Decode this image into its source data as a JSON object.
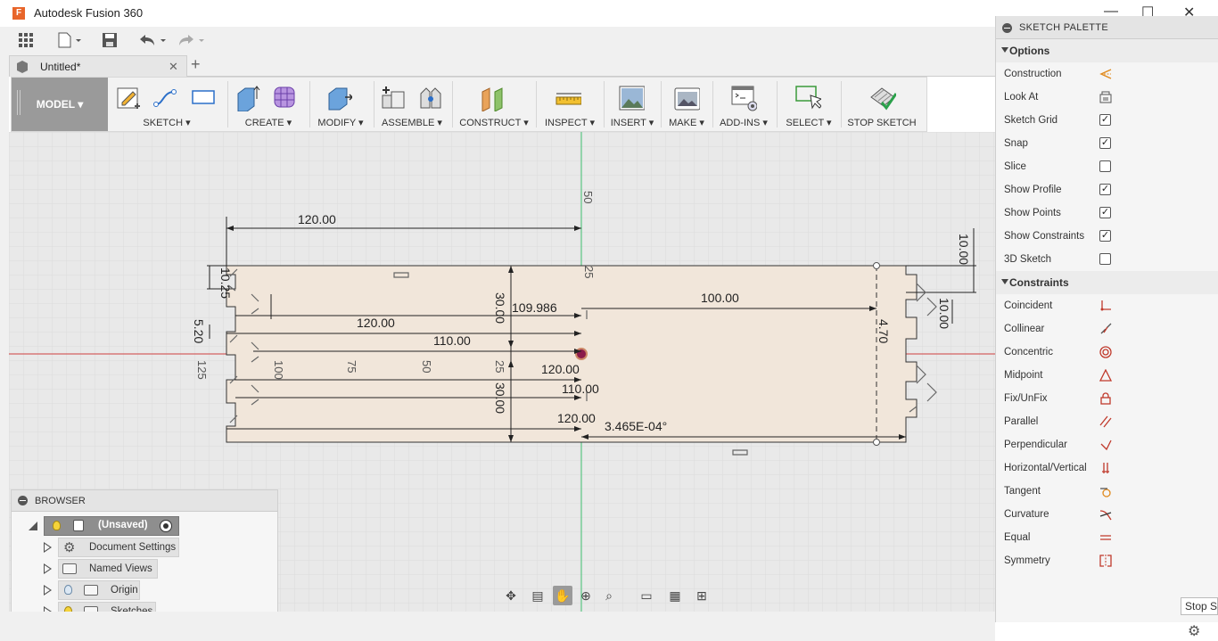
{
  "window": {
    "title": "Autodesk Fusion 360",
    "app_icon": "F",
    "minimize": "—",
    "maximize": "☐",
    "close": "✕"
  },
  "quickbar": {
    "icons": [
      "grid-icon",
      "file-icon",
      "save-icon",
      "undo-icon",
      "redo-icon"
    ]
  },
  "tab": {
    "label": "Untitled*",
    "close": "✕",
    "add": "+"
  },
  "ribbon": {
    "workspace": "MODEL",
    "groups": [
      {
        "label": "SKETCH"
      },
      {
        "label": "CREATE"
      },
      {
        "label": "MODIFY"
      },
      {
        "label": "ASSEMBLE"
      },
      {
        "label": "CONSTRUCT"
      },
      {
        "label": "INSPECT"
      },
      {
        "label": "INSERT"
      },
      {
        "label": "MAKE"
      },
      {
        "label": "ADD-INS"
      },
      {
        "label": "SELECT"
      },
      {
        "label": "STOP SKETCH"
      }
    ]
  },
  "canvas": {
    "dims": {
      "d_120_top": "120.00",
      "d_10_25": "10.25",
      "d_5_20": "5.20",
      "d_125": "125",
      "d_30_upper": "30.00",
      "d_109": "109.986",
      "d_120_mid": "120.00",
      "d_110_mid": "110.00",
      "d_100": "100.00",
      "d_120_low": "120.00",
      "d_110_low": "110.00",
      "d_30_lower": "30.00",
      "d_120_bottom": "120.00",
      "d_angle": "3.465E-04°",
      "d_10_right_top": "10.00",
      "d_10_right_mid": "10.00",
      "d_4_70": "4.70",
      "tick_50_top": "50",
      "tick_25_top": "25",
      "tick_100": "100",
      "tick_75": "75",
      "tick_50": "50",
      "tick_25": "25"
    },
    "colors": {
      "sketch_fill": "#f1e6da",
      "x_axis": "#d04040",
      "y_axis": "#3dbf6f",
      "origin": "#8b1a4a"
    }
  },
  "palette": {
    "title": "SKETCH PALETTE",
    "options_title": "Options",
    "options": [
      {
        "label": "Construction",
        "icon": "construction-icon"
      },
      {
        "label": "Look At",
        "icon": "look-at-icon"
      },
      {
        "label": "Sketch Grid",
        "checked": "✓"
      },
      {
        "label": "Snap",
        "checked": "✓"
      },
      {
        "label": "Slice",
        "checked": ""
      },
      {
        "label": "Show Profile",
        "checked": "✓"
      },
      {
        "label": "Show Points",
        "checked": "✓"
      },
      {
        "label": "Show Constraints",
        "checked": "✓"
      },
      {
        "label": "3D Sketch",
        "checked": ""
      }
    ],
    "constraints_title": "Constraints",
    "constraints": [
      {
        "label": "Coincident",
        "icon": "coincident-icon"
      },
      {
        "label": "Collinear",
        "icon": "collinear-icon"
      },
      {
        "label": "Concentric",
        "icon": "concentric-icon"
      },
      {
        "label": "Midpoint",
        "icon": "midpoint-icon"
      },
      {
        "label": "Fix/UnFix",
        "icon": "lock-icon"
      },
      {
        "label": "Parallel",
        "icon": "parallel-icon"
      },
      {
        "label": "Perpendicular",
        "icon": "perpendicular-icon"
      },
      {
        "label": "Horizontal/Vertical",
        "icon": "horizontal-vertical-icon"
      },
      {
        "label": "Tangent",
        "icon": "tangent-icon"
      },
      {
        "label": "Curvature",
        "icon": "curvature-icon"
      },
      {
        "label": "Equal",
        "icon": "equal-icon"
      },
      {
        "label": "Symmetry",
        "icon": "symmetry-icon"
      }
    ],
    "stop_button": "Stop S"
  },
  "browser": {
    "title": "BROWSER",
    "root": "(Unsaved)",
    "items": [
      {
        "label": "Document Settings"
      },
      {
        "label": "Named Views"
      },
      {
        "label": "Origin"
      },
      {
        "label": "Sketches"
      }
    ]
  }
}
